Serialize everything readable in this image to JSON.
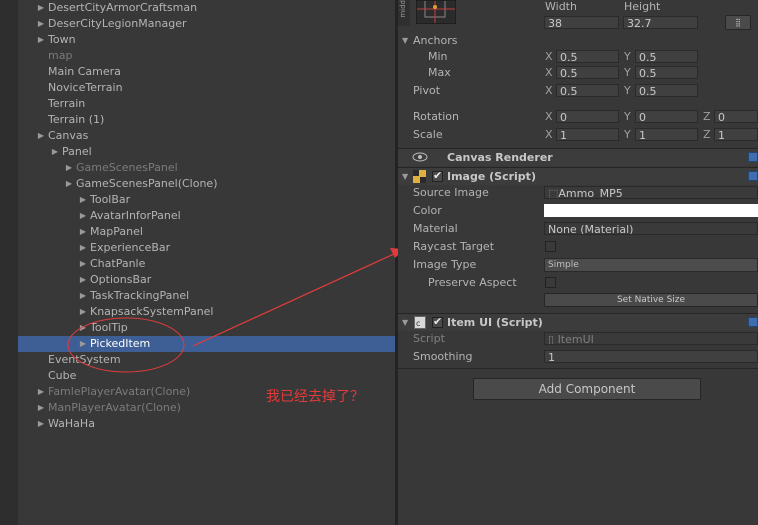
{
  "hierarchy": {
    "items": [
      {
        "label": "DesertCityArmorCraftsman",
        "arrow": true,
        "dim": false
      },
      {
        "label": "DeserCityLegionManager",
        "arrow": true,
        "dim": false
      },
      {
        "label": "Town",
        "arrow": true,
        "dim": false
      },
      {
        "label": "map",
        "arrow": false,
        "dim": true
      },
      {
        "label": "Main Camera",
        "arrow": false,
        "dim": false
      },
      {
        "label": "NoviceTerrain",
        "arrow": false,
        "dim": false
      },
      {
        "label": "Terrain",
        "arrow": false,
        "dim": false
      },
      {
        "label": "Terrain (1)",
        "arrow": false,
        "dim": false
      },
      {
        "label": "Canvas",
        "arrow": true,
        "dim": false
      },
      {
        "label": "Panel",
        "arrow": true,
        "dim": false
      },
      {
        "label": "GameScenesPanel",
        "arrow": true,
        "dim": true
      },
      {
        "label": "GameScenesPanel(Clone)",
        "arrow": true,
        "dim": false
      },
      {
        "label": "ToolBar",
        "arrow": true,
        "dim": false
      },
      {
        "label": "AvatarInforPanel",
        "arrow": true,
        "dim": false
      },
      {
        "label": "MapPanel",
        "arrow": true,
        "dim": false
      },
      {
        "label": "ExperienceBar",
        "arrow": true,
        "dim": false
      },
      {
        "label": "ChatPanle",
        "arrow": true,
        "dim": false
      },
      {
        "label": "OptionsBar",
        "arrow": true,
        "dim": false
      },
      {
        "label": "TaskTrackingPanel",
        "arrow": true,
        "dim": false
      },
      {
        "label": "KnapsackSystemPanel",
        "arrow": true,
        "dim": false
      },
      {
        "label": "ToolTip",
        "arrow": true,
        "dim": false
      },
      {
        "label": "PickedItem",
        "arrow": true,
        "dim": false,
        "selected": true
      },
      {
        "label": "EventSystem",
        "arrow": false,
        "dim": false
      },
      {
        "label": "Cube",
        "arrow": false,
        "dim": false
      },
      {
        "label": "FamlePlayerAvatar(Clone)",
        "arrow": true,
        "dim": true
      },
      {
        "label": "ManPlayerAvatar(Clone)",
        "arrow": true,
        "dim": true
      },
      {
        "label": "WaHaHa",
        "arrow": true,
        "dim": false
      }
    ]
  },
  "annotation": {
    "text": "我已经去掉了？",
    "color": "#e23b3b"
  },
  "inspector": {
    "anchor_preset_label": "midd",
    "rect": {
      "width_label": "Width",
      "height_label": "Height",
      "width_value": "38",
      "height_value": "32.7",
      "raw_edit_icon": "raw-edit-icon"
    },
    "anchors": {
      "label": "Anchors",
      "min_label": "Min",
      "min_x": "0.5",
      "min_y": "0.5",
      "max_label": "Max",
      "max_x": "0.5",
      "max_y": "0.5"
    },
    "pivot": {
      "label": "Pivot",
      "x": "0.5",
      "y": "0.5"
    },
    "rotation": {
      "label": "Rotation",
      "x": "0",
      "y": "0",
      "z": "0"
    },
    "scale": {
      "label": "Scale",
      "x": "1",
      "y": "1",
      "z": "1"
    },
    "axes": {
      "x": "X",
      "y": "Y",
      "z": "Z"
    },
    "canvas_renderer": {
      "title": "Canvas Renderer"
    },
    "image": {
      "title": "Image (Script)",
      "source_image_label": "Source Image",
      "source_image_value": "Ammo_MP5",
      "color_label": "Color",
      "material_label": "Material",
      "material_value": "None (Material)",
      "raycast_label": "Raycast Target",
      "image_type_label": "Image Type",
      "image_type_value": "Simple",
      "preserve_label": "Preserve Aspect",
      "set_native_label": "Set Native Size"
    },
    "item_ui": {
      "title": "Item UI (Script)",
      "script_label": "Script",
      "script_value": "ItemUI",
      "smoothing_label": "Smoothing",
      "smoothing_value": "1"
    },
    "add_component_label": "Add Component"
  },
  "colors": {
    "selection": "#3e5f96",
    "annotation": "#e23b3b",
    "help_blue": "#3d6fb0"
  }
}
